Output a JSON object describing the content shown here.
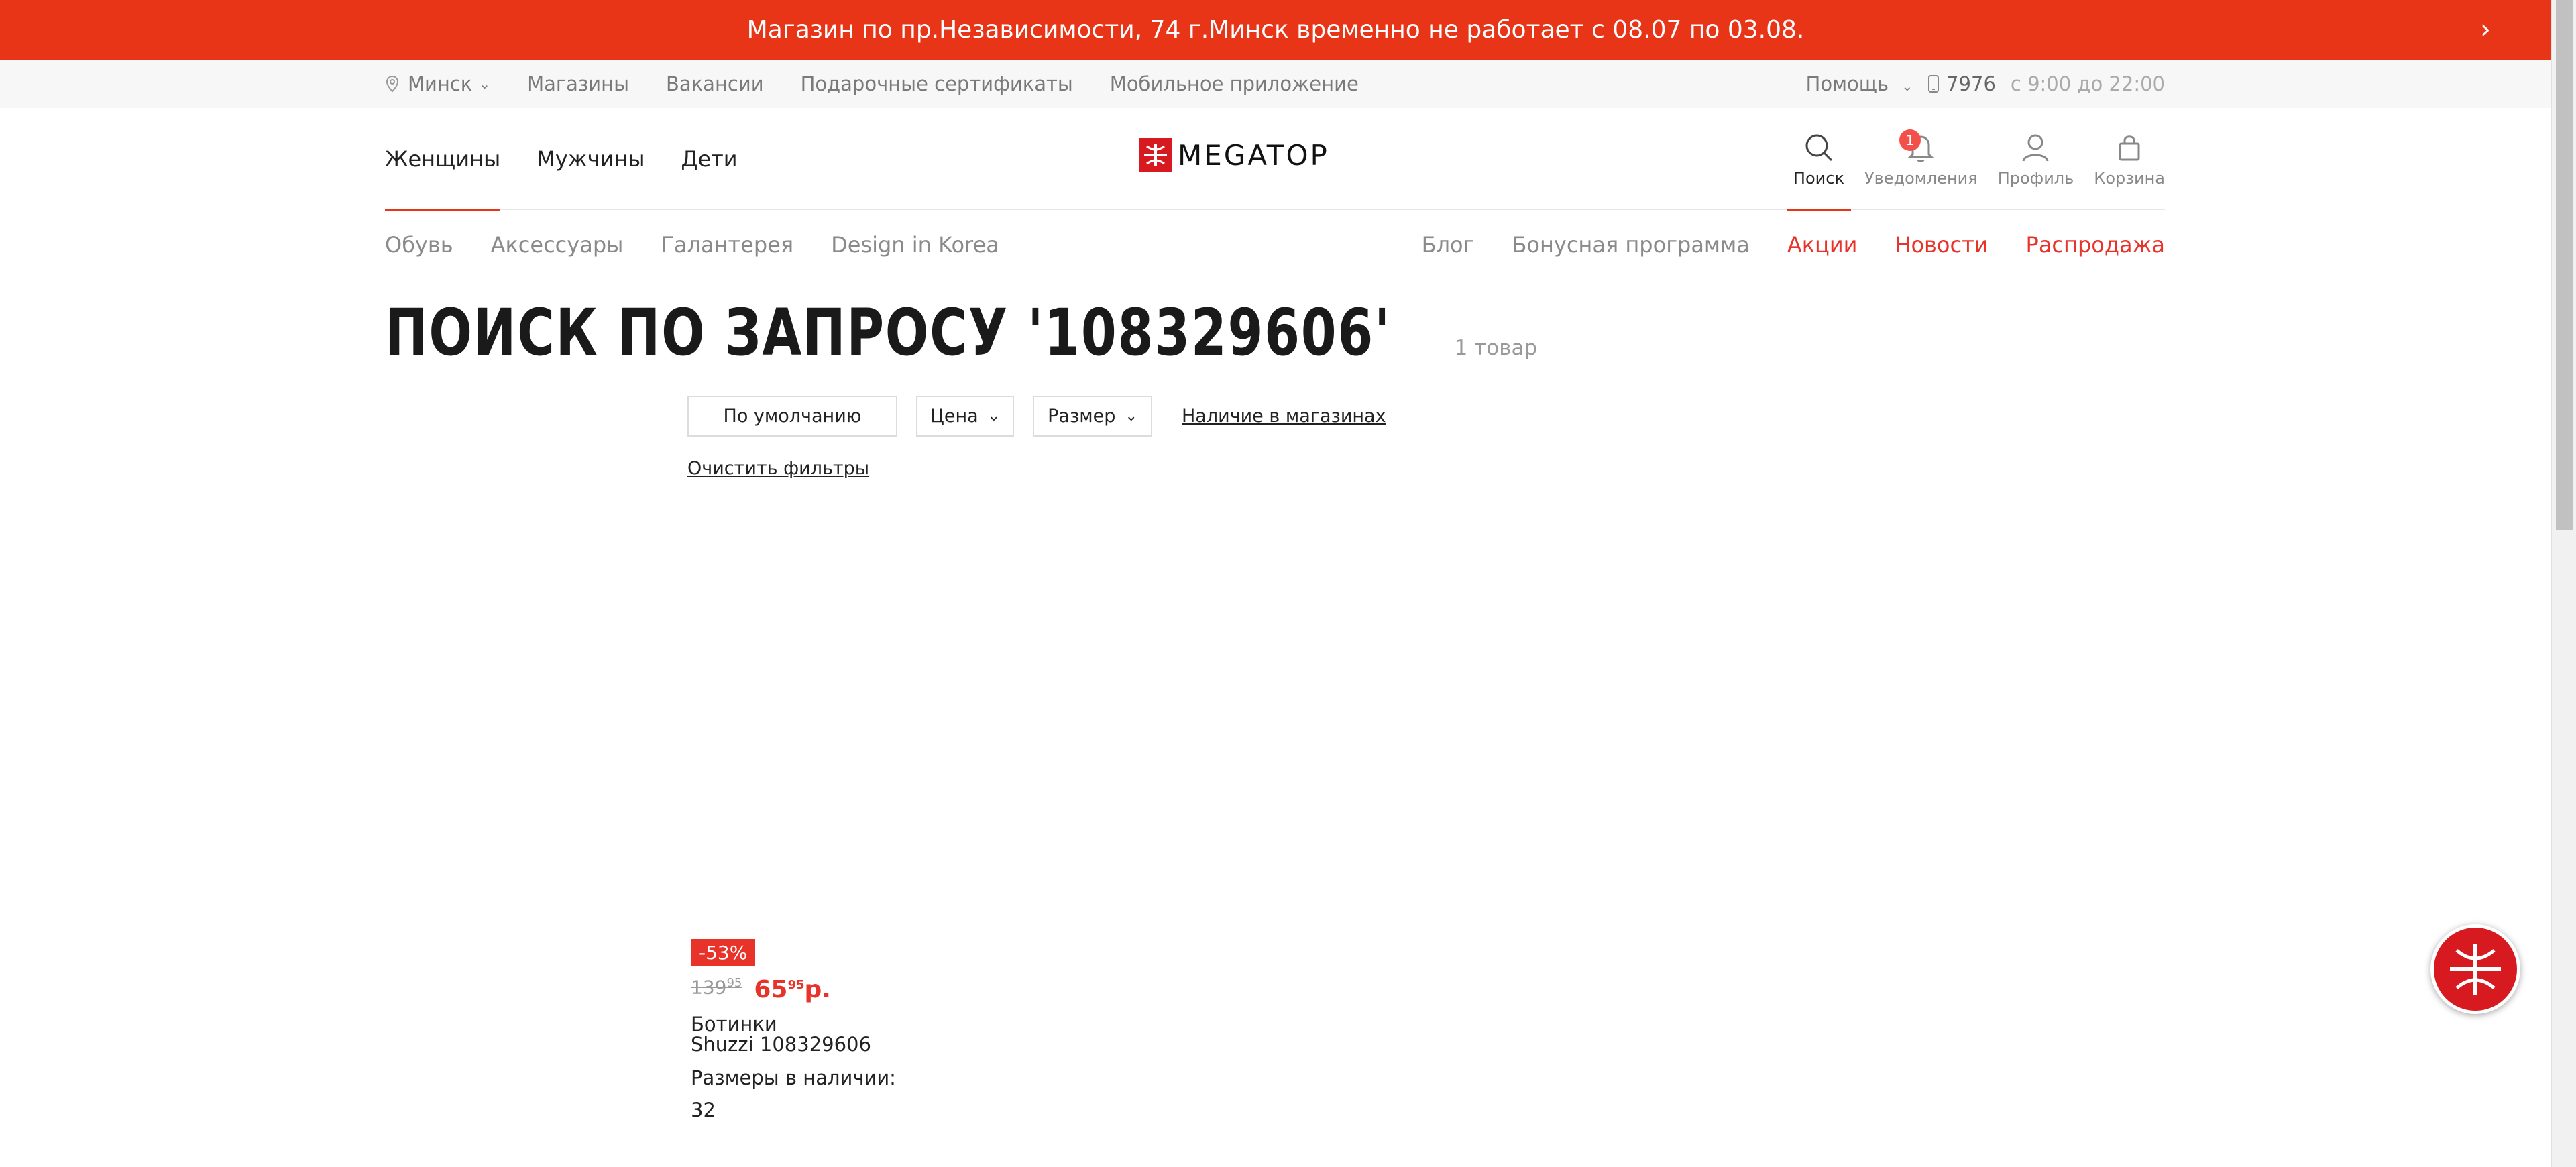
{
  "announcement": {
    "text": "Магазин по пр.Независимости, 74 г.Минск временно не работает с 08.07 по 03.08.",
    "arrow": "›"
  },
  "utility": {
    "city": "Минск",
    "links": [
      "Магазины",
      "Вакансии",
      "Подарочные сертификаты",
      "Мобильное приложение"
    ],
    "help": "Помощь",
    "phone": "7976",
    "hours": "с 9:00 до 22:00"
  },
  "header": {
    "nav": [
      "Женщины",
      "Мужчины",
      "Дети"
    ],
    "logo_text": "MEGATOP",
    "tools": {
      "search": "Поиск",
      "notifications": "Уведомления",
      "notifications_count": "1",
      "profile": "Профиль",
      "cart": "Корзина"
    }
  },
  "subnav": {
    "left": [
      "Обувь",
      "Аксессуары",
      "Галантерея",
      "Design in Korea"
    ],
    "blog": "Блог",
    "bonus": "Бонусная программа",
    "promo": "Акции",
    "news": "Новости",
    "sale": "Распродажа"
  },
  "search": {
    "title": "ПОИСК ПО ЗАПРОСУ '108329606'",
    "count": "1 товар"
  },
  "filters": {
    "sort": "По умолчанию",
    "price": "Цена",
    "size": "Размер",
    "stock": "Наличие в магазинах",
    "clear": "Очистить фильтры"
  },
  "product": {
    "discount": "-53%",
    "old_price_main": "139",
    "old_price_cents": "95",
    "new_price_main": "65",
    "new_price_cents": "95",
    "new_price_currency": "р.",
    "name_line1": "Ботинки",
    "name_line2": "Shuzzi 108329606",
    "sizes_label": "Размеры в наличии:",
    "sizes": "32"
  },
  "colors": {
    "accent": "#e83417",
    "price": "#e8332a",
    "chat": "#d71920"
  }
}
